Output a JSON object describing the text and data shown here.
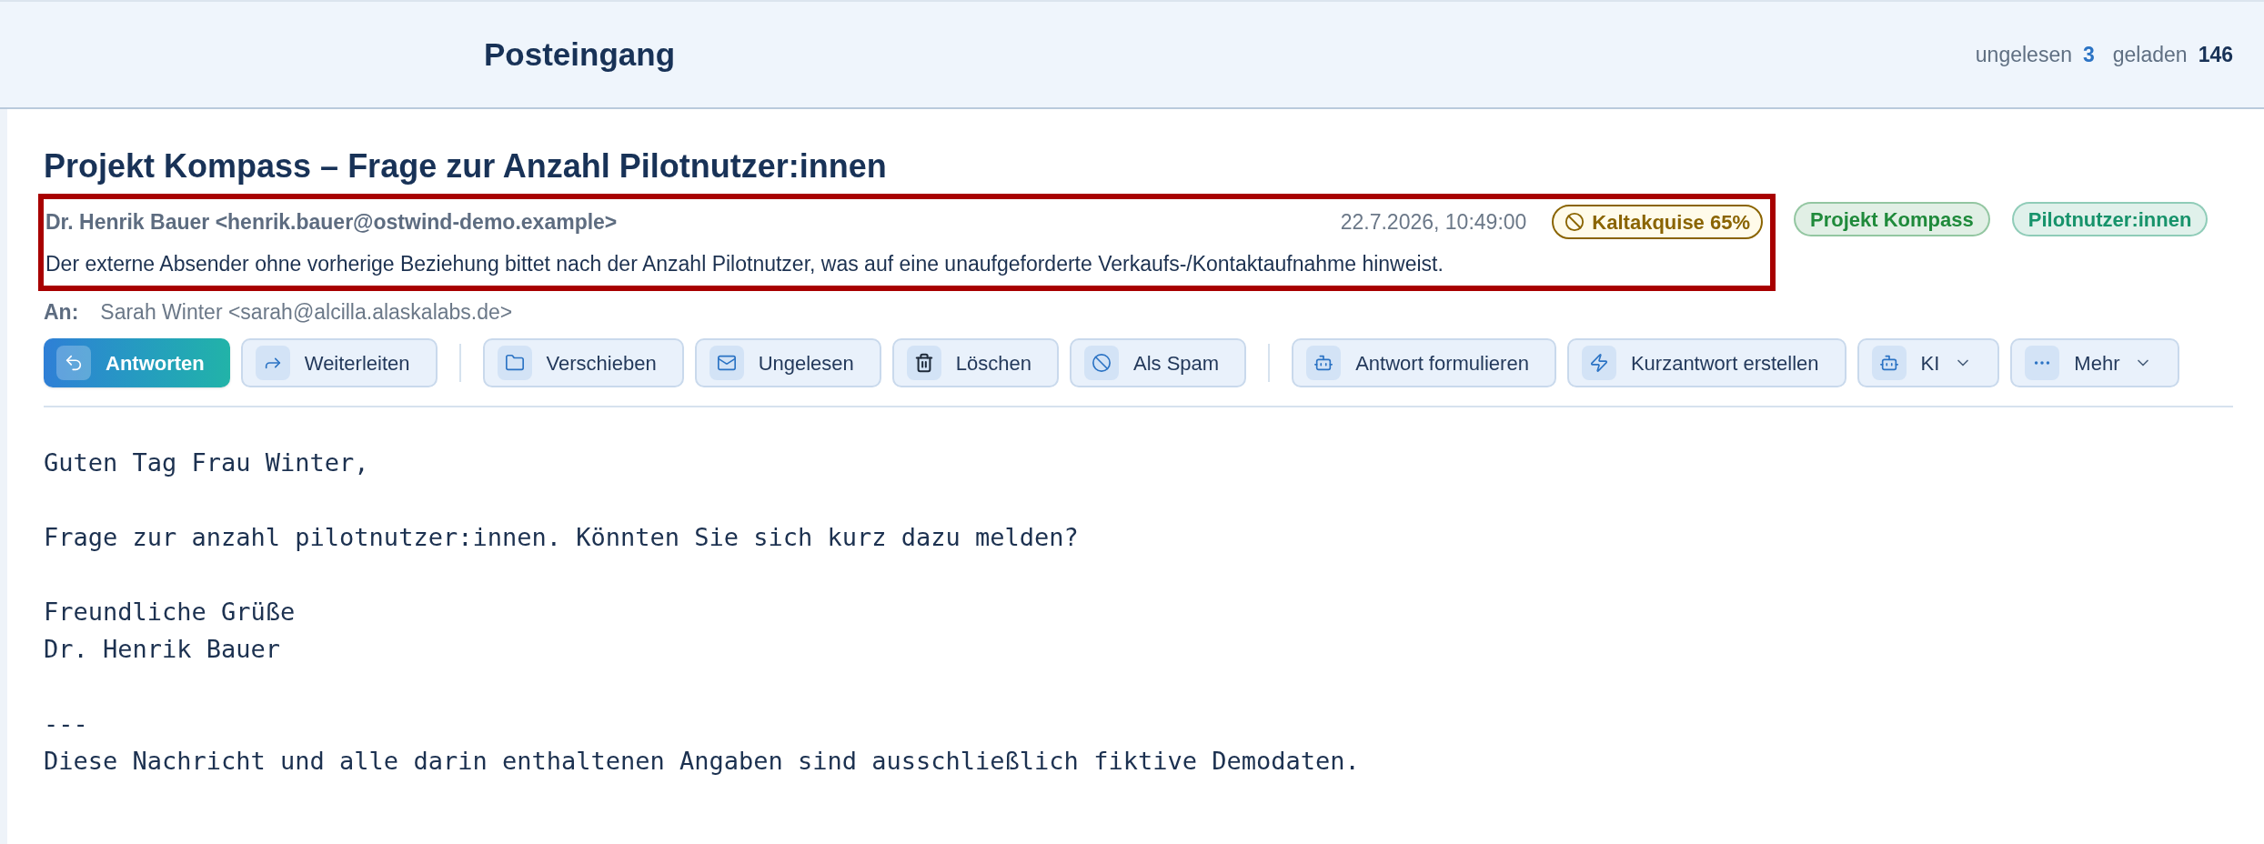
{
  "header": {
    "title": "Posteingang",
    "counters": [
      {
        "label": "ungelesen",
        "value": "3",
        "kind": "accent"
      },
      {
        "label": "geladen",
        "value": "146",
        "kind": "plain"
      }
    ]
  },
  "message": {
    "subject": "Projekt Kompass – Frage zur Anzahl Pilotnutzer:innen",
    "summary_block": {
      "highlighted": true,
      "sender": "Dr. Henrik Bauer <henrik.bauer@ostwind-demo.example>",
      "date": "22.7.2026, 10:49:00",
      "classification": "Kaltakquise 65%",
      "summary": "Der externe Absender ohne vorherige Beziehung bittet nach der Anzahl Pilotnutzer, was auf eine unaufgeforderte Verkaufs-/Kontaktaufnahme hinweist."
    },
    "tags": [
      {
        "label": "Projekt Kompass",
        "color": "#1f8a3b"
      },
      {
        "label": "Pilotnutzer:innen",
        "color": "#17936b"
      }
    ],
    "to_label": "An:",
    "to": "Sarah Winter <sarah@alcilla.alaskalabs.de>",
    "toolbar": [
      [
        {
          "label": "Antworten",
          "kind": "reply",
          "primary": true,
          "dropdown": false
        },
        {
          "label": "Weiterleiten",
          "kind": "forward",
          "primary": false,
          "dropdown": false
        }
      ],
      [
        {
          "label": "Verschieben",
          "kind": "folder",
          "primary": false,
          "dropdown": false
        },
        {
          "label": "Ungelesen",
          "kind": "mail",
          "primary": false,
          "dropdown": false
        },
        {
          "label": "Löschen",
          "kind": "trash",
          "primary": false,
          "dropdown": false
        },
        {
          "label": "Als Spam",
          "kind": "spam",
          "primary": false,
          "dropdown": false
        }
      ],
      [
        {
          "label": "Antwort formulieren",
          "kind": "bot",
          "primary": false,
          "dropdown": false
        },
        {
          "label": "Kurzantwort erstellen",
          "kind": "bolt",
          "primary": false,
          "dropdown": false
        },
        {
          "label": "KI",
          "kind": "bot",
          "primary": false,
          "dropdown": true
        },
        {
          "label": "Mehr",
          "kind": "dots",
          "primary": false,
          "dropdown": true
        }
      ]
    ],
    "body": [
      [
        "Guten Tag Frau Winter,"
      ],
      [
        "Frage zur anzahl pilotnutzer:innen. Könnten Sie sich kurz dazu melden?"
      ],
      [
        "Freundliche Grüße",
        "Dr. Henrik Bauer"
      ],
      [
        "---",
        "Diese Nachricht und alle darin enthaltenen Angaben sind ausschließlich fiktive Demodaten."
      ]
    ]
  }
}
